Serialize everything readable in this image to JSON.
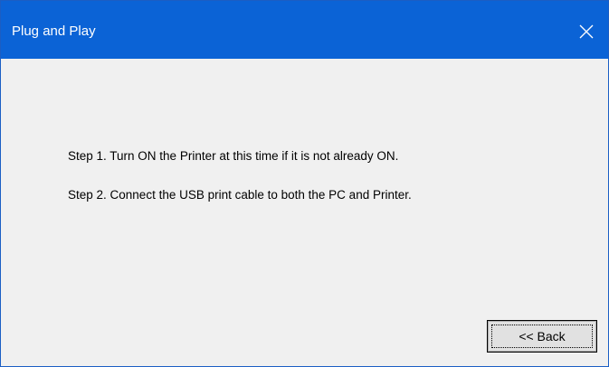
{
  "window": {
    "title": "Plug and Play",
    "close_icon": "close-icon"
  },
  "content": {
    "steps": [
      "Step 1.  Turn ON the Printer at this time if it is not already ON.",
      "Step 2.  Connect the USB print cable to both the PC and Printer."
    ]
  },
  "buttons": {
    "back_label": "<< Back"
  },
  "colors": {
    "titlebar": "#0b63d6",
    "window_border": "#1b5ec4",
    "background": "#f0f0f0",
    "button_face": "#e1e1e1"
  }
}
